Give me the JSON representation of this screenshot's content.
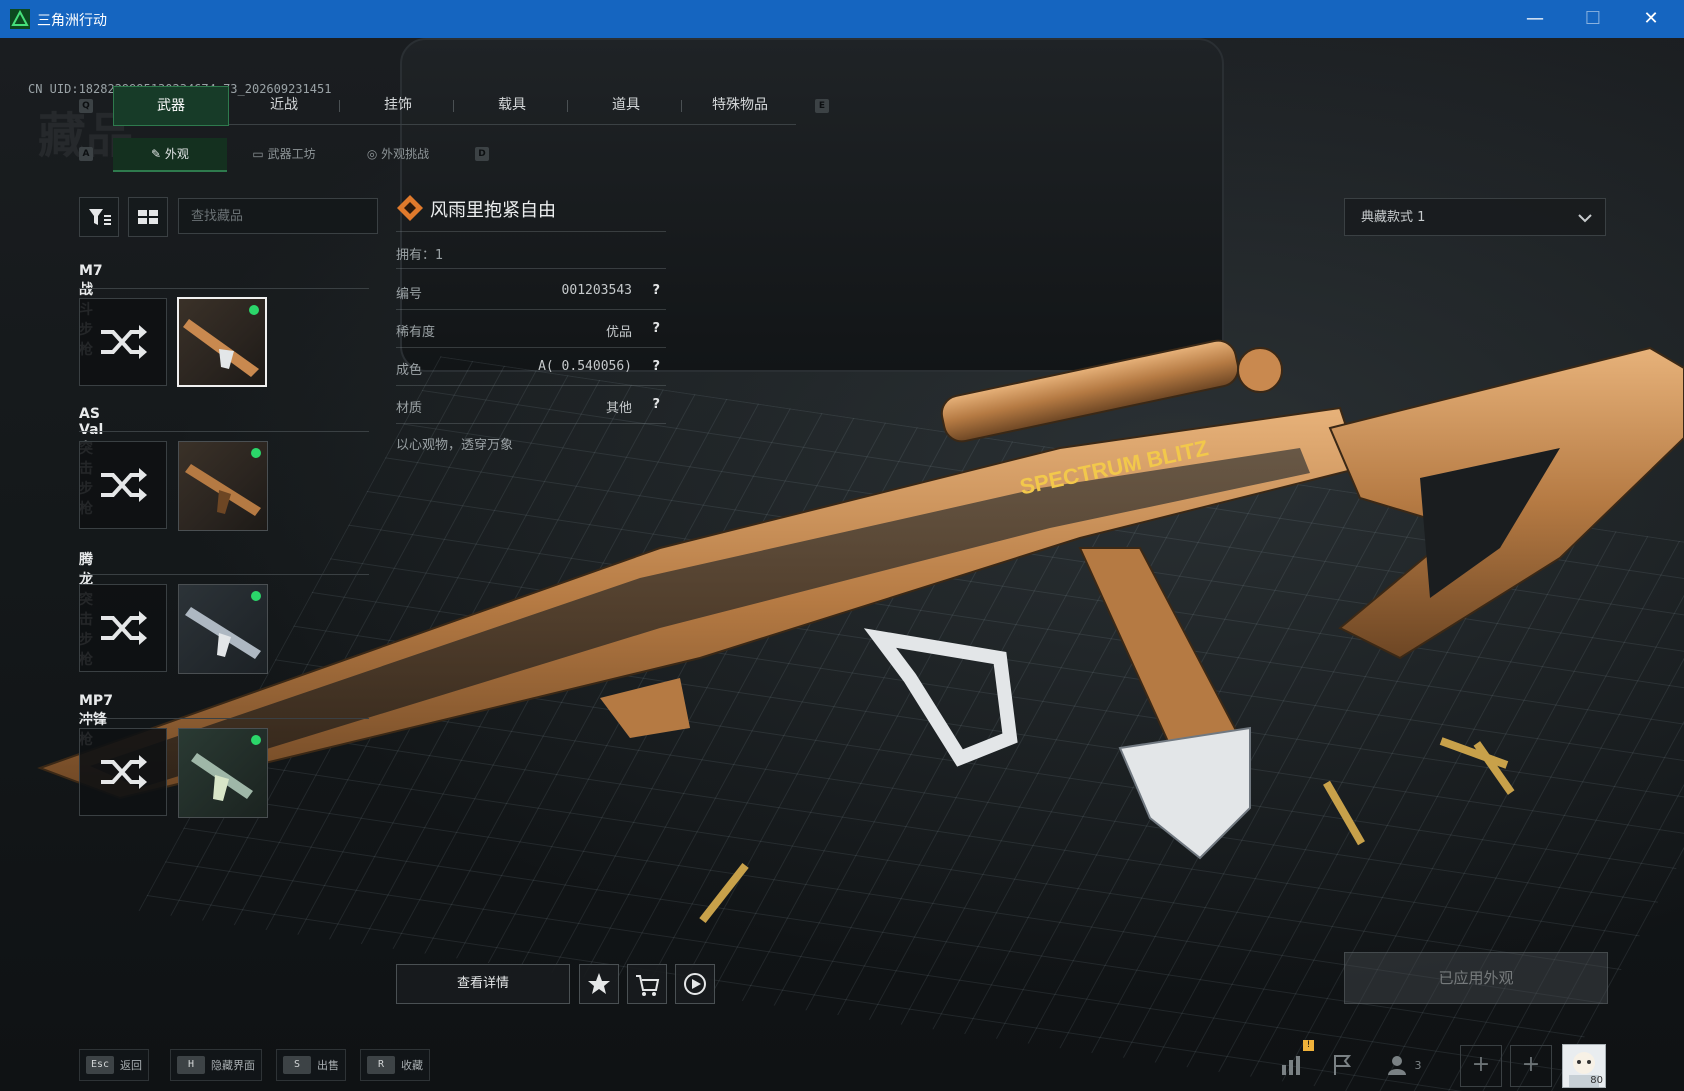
{
  "window": {
    "title": "三角洲行动",
    "minimize": "—",
    "maximize": "☐",
    "close": "✕"
  },
  "uid_text": "CN UID:1828229995130234674 73_202609231451",
  "watermark": "藏品",
  "key_hints": {
    "prev_cat": "Q",
    "next_cat": "E",
    "prev_sub": "A",
    "next_sub": "D"
  },
  "categories": [
    {
      "label": "武器",
      "active": true
    },
    {
      "label": "近战",
      "active": false
    },
    {
      "label": "挂饰",
      "active": false
    },
    {
      "label": "载具",
      "active": false
    },
    {
      "label": "道具",
      "active": false
    },
    {
      "label": "特殊物品",
      "active": false
    }
  ],
  "subtabs": [
    {
      "label": "外观",
      "icon": "brush-icon",
      "active": true
    },
    {
      "label": "武器工坊",
      "icon": "workshop-icon",
      "active": false
    },
    {
      "label": "外观挑战",
      "icon": "challenge-icon",
      "active": false
    }
  ],
  "search": {
    "placeholder": "查找藏品",
    "value": ""
  },
  "weapons": [
    {
      "name": "M7战斗步枪",
      "selected": true
    },
    {
      "name": "AS Val突击步枪",
      "selected": false
    },
    {
      "name": "腾龙突击步枪",
      "selected": false
    },
    {
      "name": "MP7冲锋枪",
      "selected": false
    }
  ],
  "detail": {
    "title": "风雨里抱紧自由",
    "owned": "拥有：1",
    "rows": [
      {
        "label": "编号",
        "value": "001203543"
      },
      {
        "label": "稀有度",
        "value": "优品"
      },
      {
        "label": "成色",
        "value": "A( 0.540056)"
      },
      {
        "label": "材质",
        "value": "其他"
      }
    ],
    "help": "?",
    "tagline": "以心观物，透穿万象"
  },
  "style_select": {
    "value": "典藏款式 1"
  },
  "buttons": {
    "details": "查看详情",
    "apply": "已应用外观"
  },
  "bottom_hints": [
    {
      "key": "Esc",
      "label": "返回"
    },
    {
      "key": "H",
      "label": "隐藏界面"
    },
    {
      "key": "S",
      "label": "出售"
    },
    {
      "key": "R",
      "label": "收藏"
    }
  ],
  "system": {
    "friends_count": "3",
    "level": "80",
    "notify": "!"
  },
  "colors": {
    "titlebar": "#1565c0",
    "accent_green": "#2e7a4d",
    "gun_gold": "#c9894f"
  }
}
